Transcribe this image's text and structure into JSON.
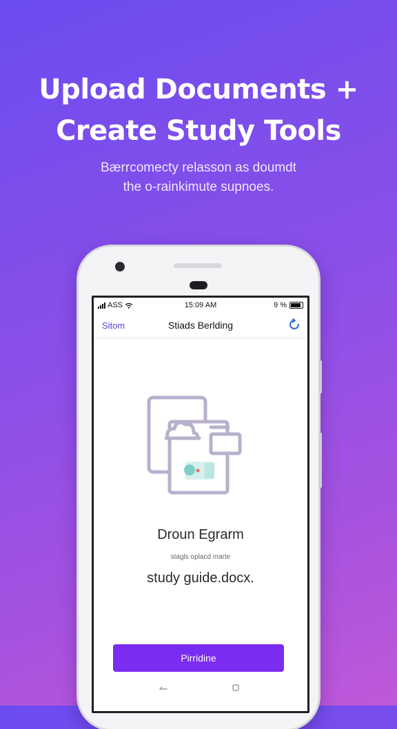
{
  "headline": {
    "line1": "Upload Documents +",
    "line2": "Create Study Tools"
  },
  "subhead": {
    "line1": "Bærrcomecty relasson as doumdt",
    "line2": "the o-rainkimute supnoes."
  },
  "status_bar": {
    "carrier": "ASS",
    "time": "15:09 AM",
    "battery_text": "9 %"
  },
  "nav_bar": {
    "back_label": "Sitom",
    "title": "Stiads Berlding",
    "action_icon": "refresh-icon"
  },
  "illustration": {
    "icon": "document-upload-icon"
  },
  "document": {
    "title": "Droun Egrarm",
    "meta": "stagls oplacd marte",
    "file_name": "study guide.docx."
  },
  "primary_button": {
    "label": "Pirridine"
  },
  "bottom_nav": {
    "back_icon": "back-icon",
    "home_icon": "home-icon"
  },
  "colors": {
    "background_start": "#6c4cf0",
    "background_end": "#c058d8",
    "accent": "#7a2cf0",
    "nav_link": "#5b3bd8",
    "action_icon": "#3b6fe0"
  }
}
